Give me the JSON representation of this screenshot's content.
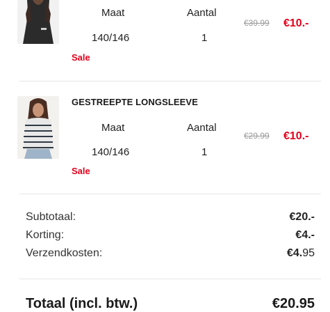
{
  "items": [
    {
      "size_label": "Maat",
      "qty_label": "Aantal",
      "size_value": "140/146",
      "qty_value": "1",
      "sale_badge": "Sale",
      "old_price": "€39.99",
      "new_price": "€10.-"
    },
    {
      "title": "GESTREEPTE LONGSLEEVE",
      "size_label": "Maat",
      "qty_label": "Aantal",
      "size_value": "140/146",
      "qty_value": "1",
      "sale_badge": "Sale",
      "old_price": "€29.99",
      "new_price": "€10.-"
    }
  ],
  "summary": {
    "subtotal_label": "Subtotaal:",
    "subtotal_value": "€20.-",
    "discount_label": "Korting:",
    "discount_value": "€4.-",
    "shipping_label": "Verzendkosten:",
    "shipping_value_main": "€4.",
    "shipping_value_dec": "95",
    "total_label": "Totaal (incl. btw.)",
    "total_value": "€20.95"
  },
  "colors": {
    "sale_red": "#e3001b",
    "strike_grey": "#9a9a9a"
  }
}
